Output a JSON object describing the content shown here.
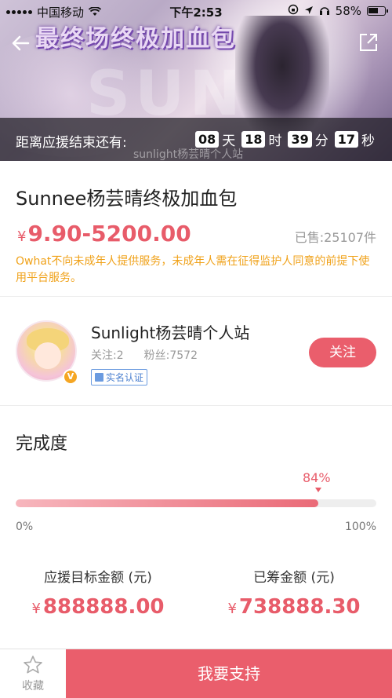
{
  "status_bar": {
    "carrier": "中国移动",
    "time": "下午2:53",
    "battery": "58%"
  },
  "banner": {
    "title": "最终场终极加血包",
    "countdown_label": "距离应援结束还有:",
    "watermark": "sunlight杨芸晴个人站",
    "countdown": {
      "days": "08",
      "days_unit": "天",
      "hours": "18",
      "hours_unit": "时",
      "minutes": "39",
      "minutes_unit": "分",
      "seconds": "17",
      "seconds_unit": "秒"
    }
  },
  "product": {
    "title": "Sunnee杨芸晴终极加血包",
    "currency": "¥",
    "price_range": "9.90-5200.00",
    "sold": "已售:25107件",
    "notice": "Owhat不向未成年人提供服务，未成年人需在征得监护人同意的前提下使用平台服务。"
  },
  "organizer": {
    "name": "Sunlight杨芸晴个人站",
    "follows": "关注:2",
    "fans": "粉丝:7572",
    "verified": "实名认证",
    "badge": "V",
    "follow_button": "关注"
  },
  "progress": {
    "heading": "完成度",
    "percent_label": "84%",
    "percent_value": 0.84,
    "scale_min": "0%",
    "scale_max": "100%",
    "target_label": "应援目标金额 (元)",
    "target_currency": "¥",
    "target_value": "888888.00",
    "raised_label": "已筹金额 (元)",
    "raised_currency": "¥",
    "raised_value": "738888.30"
  },
  "bottom_bar": {
    "favorite_label": "收藏",
    "support_button": "我要支持"
  },
  "colors": {
    "accent": "#ea5e6c",
    "notice": "#f0a21a",
    "verify": "#4a7fcf"
  }
}
